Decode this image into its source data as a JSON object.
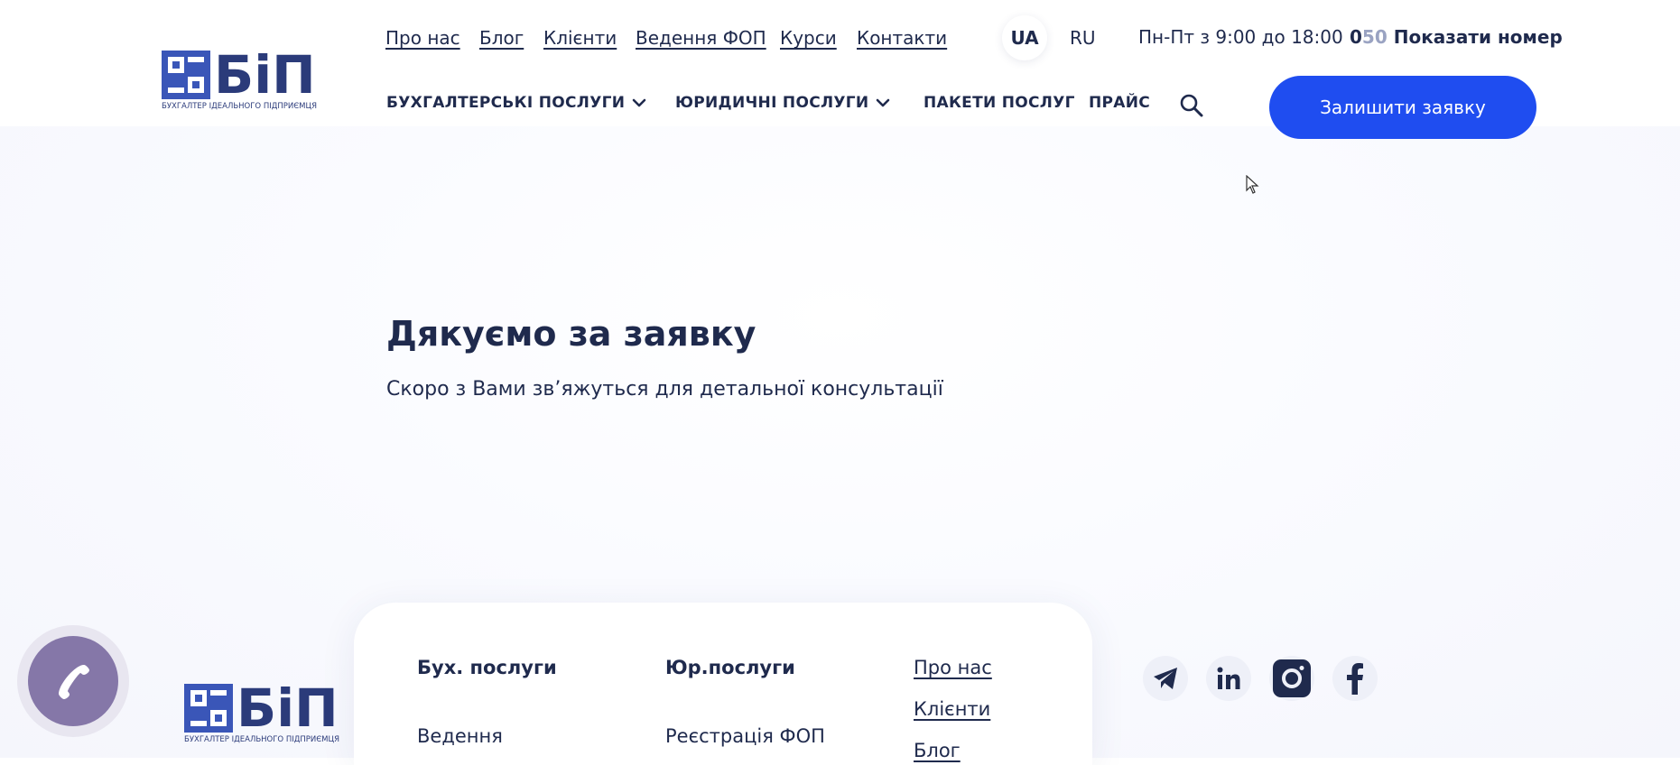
{
  "logo": {
    "text": "БіП",
    "subtitle": "БУХГАЛТЕР ІДЕАЛЬНОГО ПІДПРИЄМЦЯ"
  },
  "top_links": [
    "Про нас",
    "Блог",
    "Клієнти",
    "Ведення ФОП",
    "Курси",
    "Контакти"
  ],
  "lang": {
    "ua": "UA",
    "ru": "RU"
  },
  "hours": "Пн-Пт з 9:00 до 18:00",
  "phone": {
    "prefix_dark": "0",
    "prefix_grey": "50",
    "label": "Показати номер"
  },
  "nav": {
    "accounting": "БУХГАЛТЕРСЬКІ ПОСЛУГИ",
    "legal": "ЮРИДИЧНІ ПОСЛУГИ",
    "packages": "ПАКЕТИ ПОСЛУГ",
    "price": "ПРАЙС"
  },
  "cta_label": "Залишити заявку",
  "main": {
    "title": "Дякуємо за заявку",
    "subtitle": "Скоро з Вами зв’яжуться для детальної консультації"
  },
  "footer": {
    "col1": {
      "heading": "Бух. послуги",
      "item": "Ведення"
    },
    "col2": {
      "heading": "Юр.послуги",
      "item": "Реєстрація ФОП"
    },
    "col3": {
      "links": [
        "Про нас",
        "Клієнти",
        "Блог"
      ]
    }
  },
  "colors": {
    "brand_blue": "#1f4df0",
    "text_navy": "#1f2a4d",
    "call_purple": "#8577a8"
  },
  "icons": [
    "search-icon",
    "chevron-down-icon",
    "telegram-icon",
    "linkedin-icon",
    "instagram-icon",
    "facebook-icon",
    "phone-icon",
    "cursor-icon"
  ]
}
